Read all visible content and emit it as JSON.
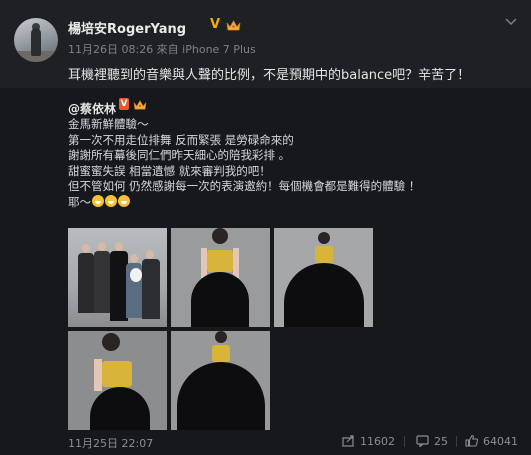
{
  "post": {
    "author": "楊培安RogerYang",
    "verified_mark": "V",
    "meta": "11月26日 08:26 來自 iPhone 7 Plus",
    "text": "耳機裡聽到的音樂與人聲的比例，不是預期中的balance吧？辛苦了！"
  },
  "repost": {
    "author": "@蔡依林",
    "verified_mark": "V",
    "lines": [
      "金馬新鮮體驗～",
      "第一次不用走位排舞 反而緊張 是勞碌命來的",
      "謝謝所有幕後同仁們昨天細心的陪我彩排 。",
      "甜蜜蜜失誤 相當遺憾 就來審判我的吧！",
      "但不管如何 仍然感謝每一次的表演邀約！每個機會都是難得的體驗 ！",
      "耶～"
    ],
    "time": "11月25日 22:07",
    "shares": "11602",
    "comments": "25",
    "likes": "64041"
  },
  "colors": {
    "background": "#1e2024",
    "repost_background": "#16181b",
    "verified_gold": "#f5b000",
    "verified_red": "#e8572e",
    "dress_gold": "#d9b43a"
  },
  "icons": [
    "crown-icon",
    "chevron-down-icon",
    "share-icon",
    "comment-icon",
    "like-icon",
    "grin-emoji-icon"
  ]
}
